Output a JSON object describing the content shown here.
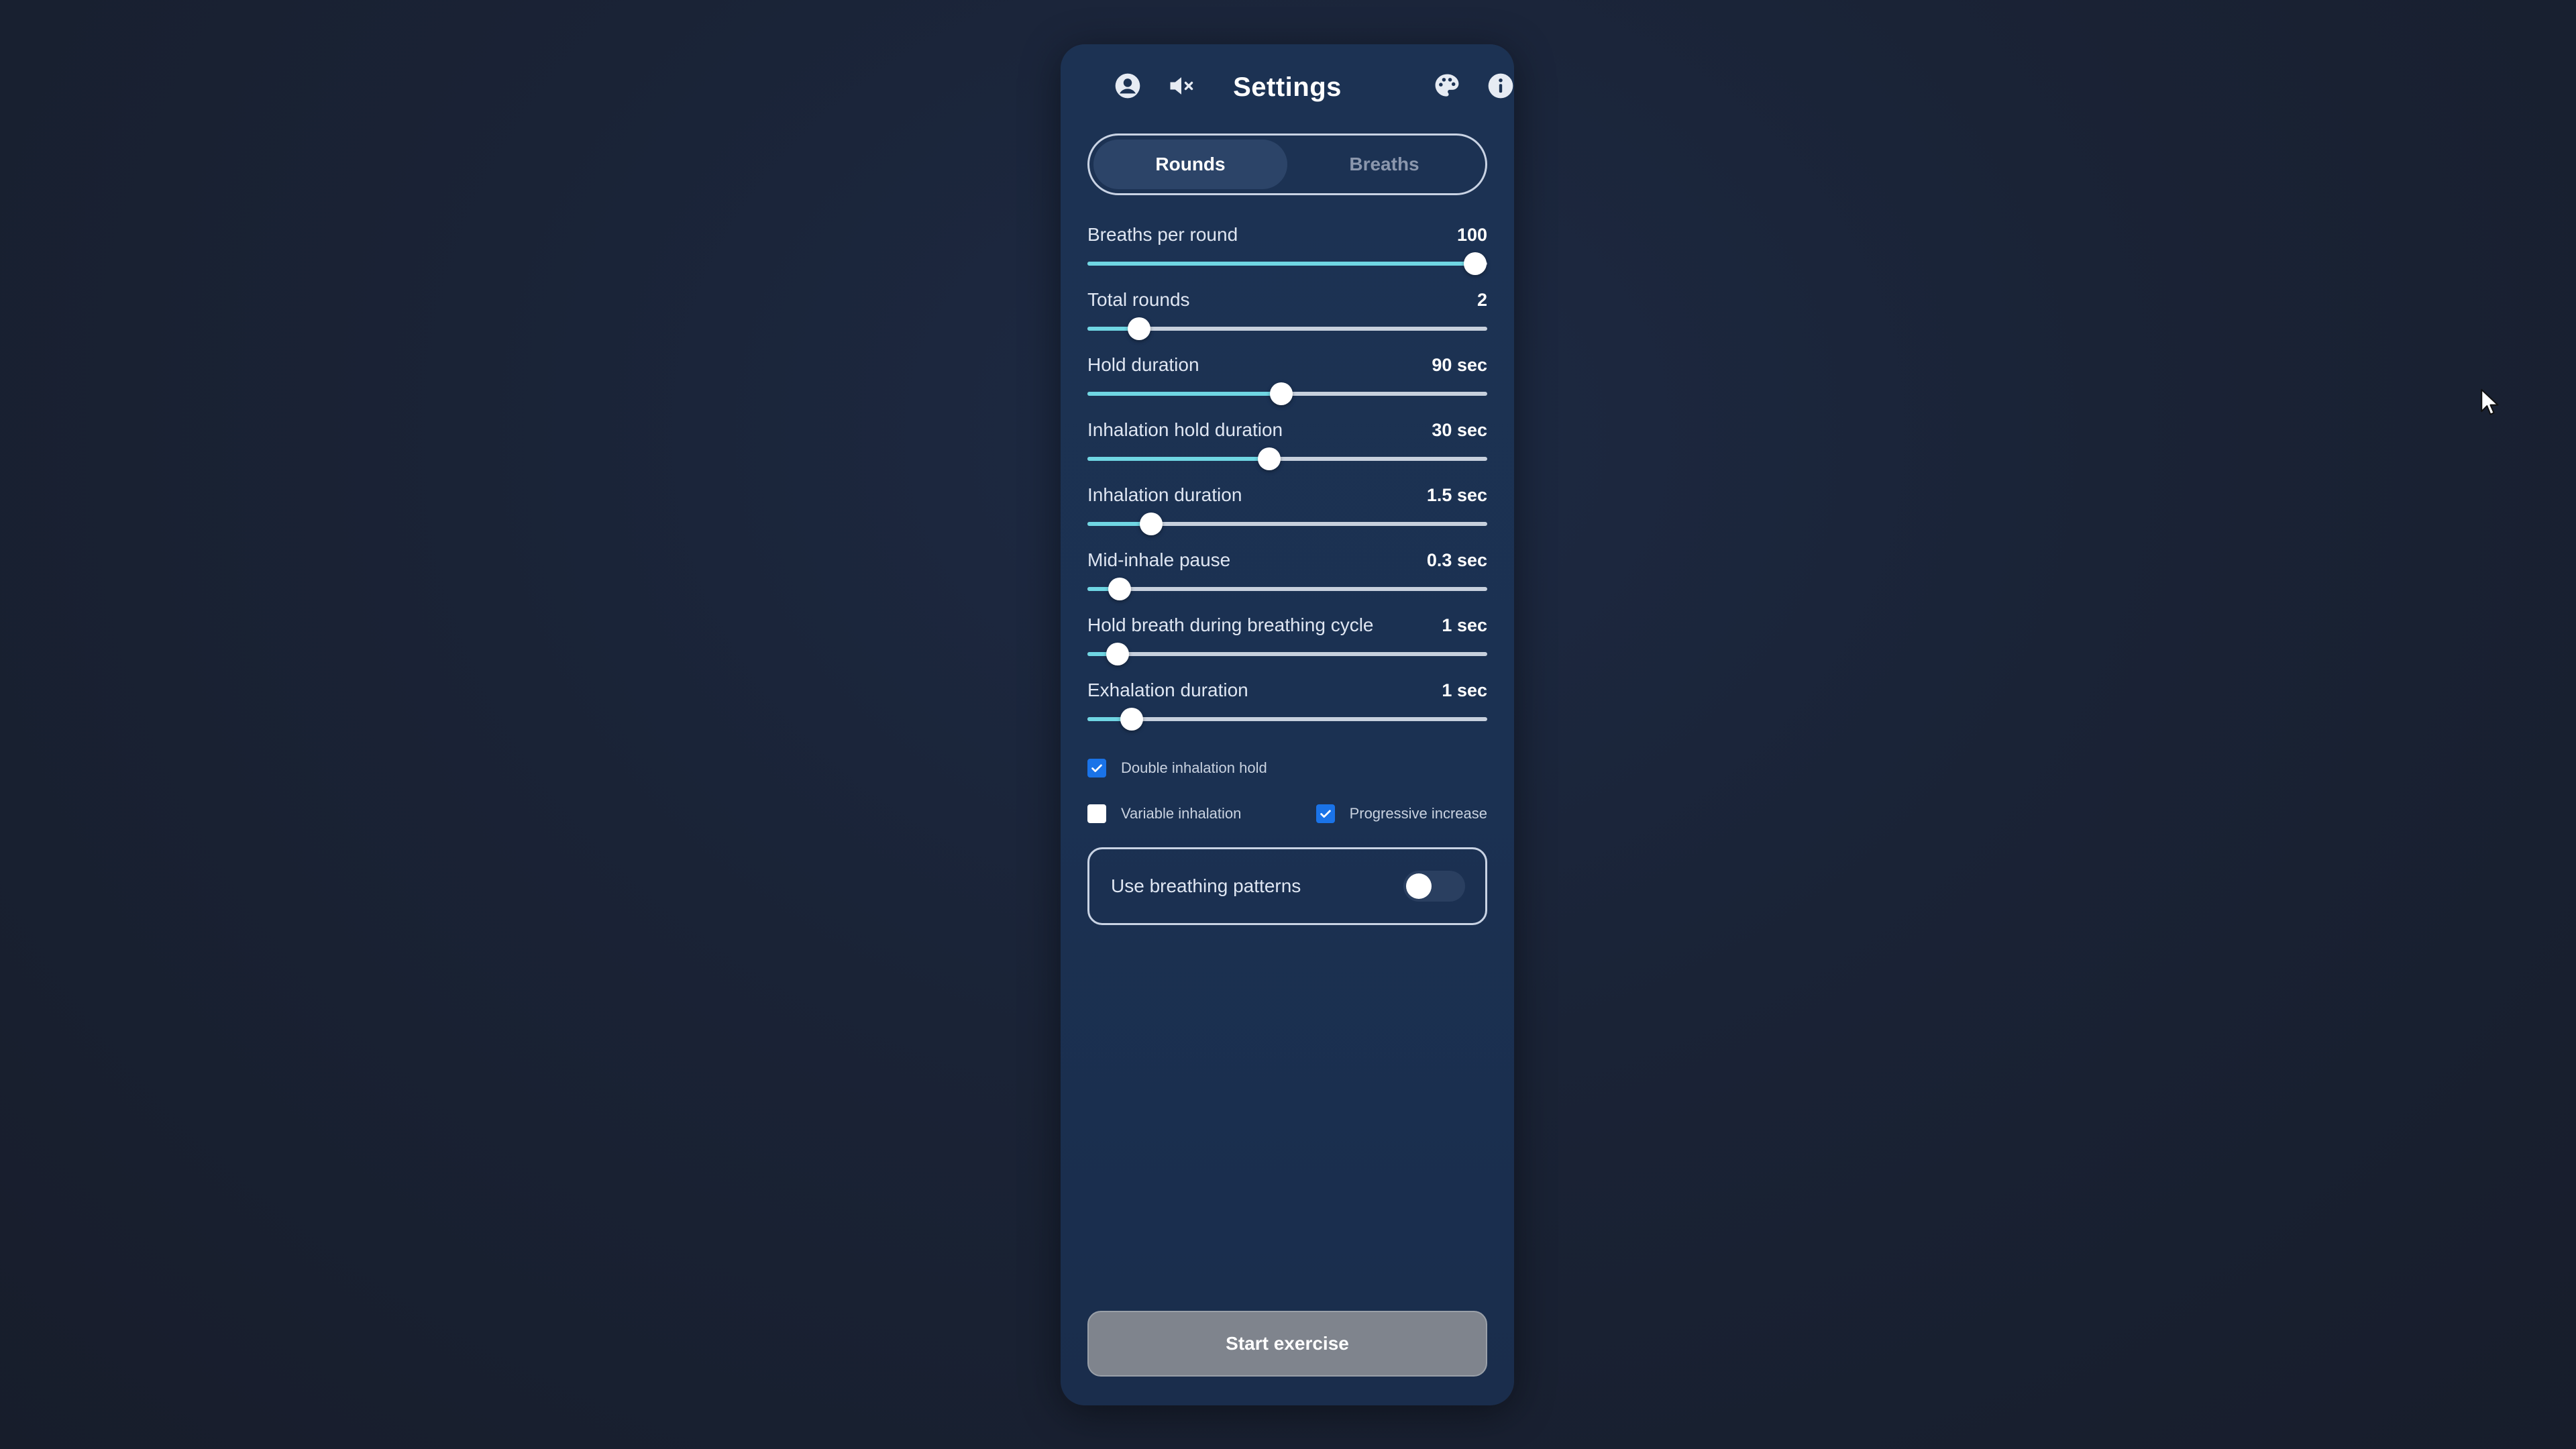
{
  "header": {
    "title": "Settings",
    "left_icons": [
      "user-icon",
      "volume-mute-icon"
    ],
    "right_icons": [
      "palette-icon",
      "info-icon"
    ]
  },
  "tabs": [
    {
      "label": "Rounds",
      "active": true
    },
    {
      "label": "Breaths",
      "active": false
    }
  ],
  "sliders": [
    {
      "label": "Breaths per round",
      "value": "100",
      "level": 0.97
    },
    {
      "label": "Total rounds",
      "value": "2",
      "level": 0.13
    },
    {
      "label": "Hold duration",
      "value": "90 sec",
      "level": 0.485
    },
    {
      "label": "Inhalation hold duration",
      "value": "30 sec",
      "level": 0.455
    },
    {
      "label": "Inhalation duration",
      "value": "1.5 sec",
      "level": 0.16
    },
    {
      "label": "Mid-inhale pause",
      "value": "0.3 sec",
      "level": 0.08
    },
    {
      "label": "Hold breath during breathing cycle",
      "value": "1 sec",
      "level": 0.075
    },
    {
      "label": "Exhalation duration",
      "value": "1 sec",
      "level": 0.11
    }
  ],
  "checkboxes": {
    "double_inhalation_hold": {
      "label": "Double inhalation hold",
      "checked": true
    },
    "variable_inhalation": {
      "label": "Variable inhalation",
      "checked": false
    },
    "progressive_increase": {
      "label": "Progressive increase",
      "checked": true
    }
  },
  "patterns": {
    "label": "Use breathing patterns",
    "enabled": false
  },
  "start_button": {
    "label": "Start exercise"
  },
  "colors": {
    "accent_fill": "#6fd6e3",
    "checkbox_checked": "#1a73e8",
    "button_disabled": "#7f848d"
  }
}
